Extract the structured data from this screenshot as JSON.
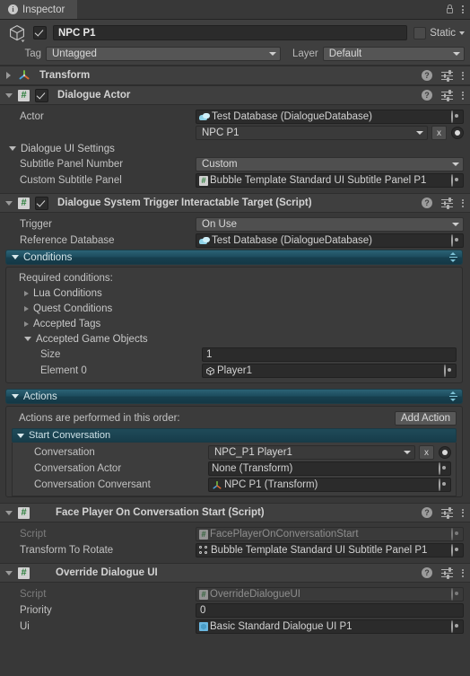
{
  "tab": {
    "label": "Inspector",
    "info_icon": "info-icon",
    "lock_icon": "lock-icon",
    "menu_icon": "kebab-menu-icon"
  },
  "gameobject": {
    "name": "NPC P1",
    "enabled": true,
    "static_label": "Static",
    "tag_label": "Tag",
    "tag_value": "Untagged",
    "layer_label": "Layer",
    "layer_value": "Default"
  },
  "components": [
    {
      "title": "Transform",
      "icon": "transform-icon",
      "expanded": false,
      "has_enable_checkbox": false
    },
    {
      "title": "Dialogue Actor",
      "icon": "script-icon",
      "expanded": true,
      "has_enable_checkbox": true,
      "rows": [
        {
          "label": "Actor",
          "type": "object",
          "value": "Test Database (DialogueDatabase)",
          "icon": "dialogue-database-icon"
        },
        {
          "label": "",
          "type": "popup-x-radio",
          "value": "NPC P1"
        },
        {
          "label": "Dialogue UI Settings",
          "type": "foldout",
          "expanded": true
        },
        {
          "label": "Subtitle Panel Number",
          "type": "popup",
          "value": "Custom"
        },
        {
          "label": "Custom Subtitle Panel",
          "type": "object",
          "value": "Bubble Template Standard UI Subtitle Panel P1",
          "icon": "script-icon"
        }
      ]
    },
    {
      "title": "Dialogue System Trigger Interactable Target (Script)",
      "icon": "script-icon",
      "expanded": true,
      "has_enable_checkbox": true,
      "rows": [
        {
          "label": "Trigger",
          "type": "popup",
          "value": "On Use"
        },
        {
          "label": "Reference Database",
          "type": "object",
          "value": "Test Database (DialogueDatabase)",
          "icon": "dialogue-database-icon"
        }
      ],
      "conditions": {
        "header": "Conditions",
        "required_label": "Required conditions:",
        "foldouts": [
          {
            "label": "Lua Conditions",
            "expanded": false
          },
          {
            "label": "Quest Conditions",
            "expanded": false
          },
          {
            "label": "Accepted Tags",
            "expanded": false
          },
          {
            "label": "Accepted Game Objects",
            "expanded": true
          }
        ],
        "size_label": "Size",
        "size_value": "1",
        "element_label": "Element 0",
        "element_value": "Player1",
        "element_icon": "gameobject-icon"
      },
      "actions": {
        "header": "Actions",
        "order_label": "Actions are performed in this order:",
        "add_button": "Add Action",
        "start_conversation": {
          "header": "Start Conversation",
          "rows": [
            {
              "label": "Conversation",
              "type": "popup-x-radio",
              "value": "NPC_P1 Player1"
            },
            {
              "label": "Conversation Actor",
              "type": "object",
              "value": "None (Transform)",
              "icon": "none-icon"
            },
            {
              "label": "Conversation Conversant",
              "type": "object",
              "value": "NPC P1 (Transform)",
              "icon": "transform-icon"
            }
          ]
        }
      }
    },
    {
      "title": "Face Player On Conversation Start (Script)",
      "icon": "script-icon",
      "expanded": true,
      "has_enable_checkbox": false,
      "rows": [
        {
          "label": "Script",
          "type": "object-readonly",
          "value": "FacePlayerOnConversationStart",
          "icon": "script-icon"
        },
        {
          "label": "Transform To Rotate",
          "type": "object",
          "value": "Bubble Template Standard UI Subtitle Panel P1",
          "icon": "rect-transform-icon"
        }
      ]
    },
    {
      "title": "Override Dialogue UI",
      "icon": "script-icon",
      "expanded": true,
      "has_enable_checkbox": false,
      "rows": [
        {
          "label": "Script",
          "type": "object-readonly",
          "value": "OverrideDialogueUI",
          "icon": "script-icon"
        },
        {
          "label": "Priority",
          "type": "number",
          "value": "0"
        },
        {
          "label": "Ui",
          "type": "object",
          "value": "Basic Standard Dialogue UI P1",
          "icon": "prefab-icon"
        }
      ]
    }
  ],
  "colors": {
    "background": "#383838",
    "header": "#3f3f3f",
    "field": "#2b2b2b",
    "teal_accent": "#1d4c5d",
    "text": "#c4c4c4"
  }
}
